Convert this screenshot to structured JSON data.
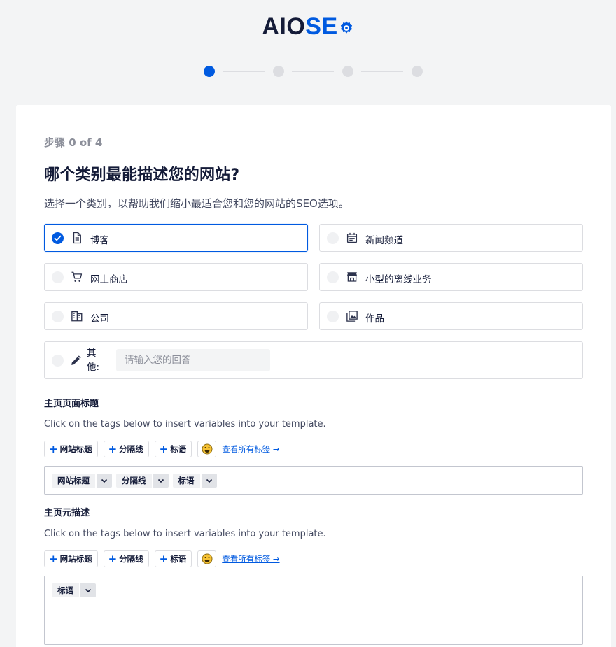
{
  "brand": {
    "part1": "AIO",
    "part2": "SE"
  },
  "stepper": {
    "total": 4,
    "current": 0
  },
  "step_label": "步骤 0 of 4",
  "title": "哪个类别最能描述您的网站?",
  "subtitle": "选择一个类别，以帮助我们缩小最适合您和您的网站的SEO选项。",
  "categories": [
    {
      "label": "博客",
      "icon": "document-icon",
      "selected": true
    },
    {
      "label": "新闻频道",
      "icon": "calendar-icon",
      "selected": false
    },
    {
      "label": "网上商店",
      "icon": "cart-icon",
      "selected": false
    },
    {
      "label": "小型的离线业务",
      "icon": "storefront-icon",
      "selected": false
    },
    {
      "label": "公司",
      "icon": "building-icon",
      "selected": false
    },
    {
      "label": "作品",
      "icon": "portfolio-icon",
      "selected": false
    }
  ],
  "other": {
    "label": "其他:",
    "placeholder": "请输入您的回答",
    "value": ""
  },
  "homepage_title": {
    "heading": "主页页面标题",
    "hint": "Click on the tags below to insert variables into your template.",
    "tag_buttons": [
      "网站标题",
      "分隔线",
      "标语"
    ],
    "view_all": "查看所有标签 →",
    "chips": [
      "网站标题",
      "分隔线",
      "标语"
    ]
  },
  "homepage_desc": {
    "heading": "主页元描述",
    "hint": "Click on the tags below to insert variables into your template.",
    "tag_buttons": [
      "网站标题",
      "分隔线",
      "标语"
    ],
    "view_all": "查看所有标签 →",
    "chips": [
      "标语"
    ]
  },
  "colors": {
    "accent": "#005ae0",
    "text": "#141b38",
    "border": "#dcdde1"
  }
}
